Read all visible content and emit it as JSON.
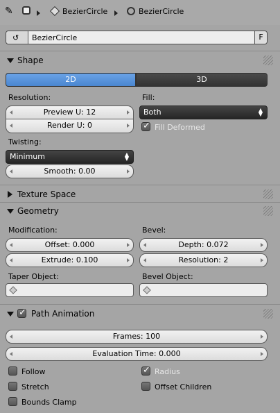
{
  "header": {
    "item1": "BezierCircle",
    "item2": "BezierCircle"
  },
  "datablock": {
    "name": "BezierCircle",
    "fake_user": "F"
  },
  "shape": {
    "title": "Shape",
    "mode_2d": "2D",
    "mode_3d": "3D",
    "resolution_label": "Resolution:",
    "preview_u": "Preview U: 12",
    "render_u": "Render U: 0",
    "fill_label": "Fill:",
    "fill_value": "Both",
    "fill_deformed": "Fill Deformed",
    "twisting_label": "Twisting:",
    "twisting_value": "Minimum",
    "smooth": "Smooth: 0.00"
  },
  "texture_space": {
    "title": "Texture Space"
  },
  "geometry": {
    "title": "Geometry",
    "modification_label": "Modification:",
    "offset": "Offset: 0.000",
    "extrude": "Extrude: 0.100",
    "bevel_label": "Bevel:",
    "depth": "Depth: 0.072",
    "resolution": "Resolution: 2",
    "taper_label": "Taper Object:",
    "bevel_object_label": "Bevel Object:"
  },
  "path_animation": {
    "title": "Path Animation",
    "frames": "Frames: 100",
    "eval_time": "Evaluation Time: 0.000",
    "follow": "Follow",
    "radius": "Radius",
    "stretch": "Stretch",
    "offset_children": "Offset Children",
    "bounds_clamp": "Bounds Clamp"
  }
}
